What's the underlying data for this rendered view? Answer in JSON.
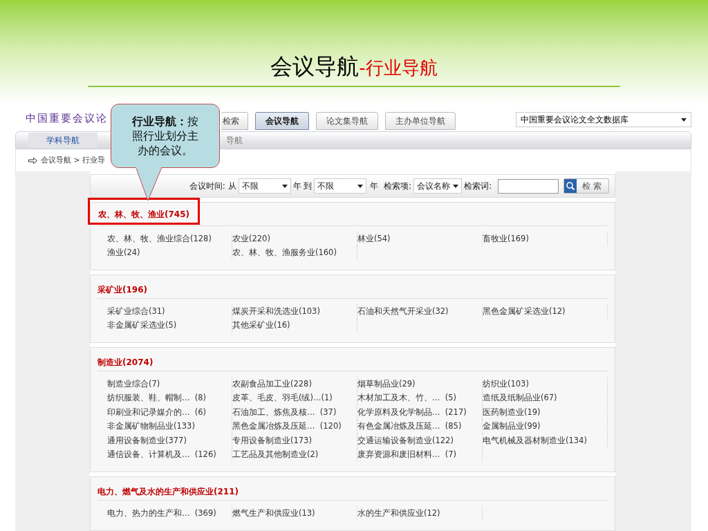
{
  "slide_title": {
    "main": "会议导航",
    "sub": "-行业导航"
  },
  "header": {
    "logo": "中国重要会议论",
    "tabs": [
      {
        "label": "检索",
        "selected": false
      },
      {
        "label": "会议导航",
        "selected": true
      },
      {
        "label": "论文集导航",
        "selected": false
      },
      {
        "label": "主办单位导航",
        "selected": false
      }
    ],
    "database_select": "中国重要会议论文全文数据库"
  },
  "subtabs": [
    "学科导航",
    "导航"
  ],
  "breadcrumb": "会议导航 > 行业导",
  "callout": "**行业导航：**按照行业划分主办的会议。",
  "search": {
    "time_label": "会议时间: 从",
    "from": "不限",
    "to_label": "年 到",
    "to": "不限",
    "field_label": "年  检索项:",
    "field": "会议名称",
    "keyword_label": "检索词:",
    "button": "检 索"
  },
  "sections": [
    {
      "title": "农、林、牧、渔业(745)",
      "highlighted": true,
      "items": [
        "农、林、牧、渔业综合(128)",
        "农业(220)",
        "林业(54)",
        "畜牧业(169)",
        "渔业(24)",
        "农、林、牧、渔服务业(160)"
      ]
    },
    {
      "title": "采矿业(196)",
      "highlighted": false,
      "items": [
        "采矿业综合(31)",
        "煤炭开采和洗选业(103)",
        "石油和天然气开采业(32)",
        "黑色金属矿采选业(12)",
        "非金属矿采选业(5)",
        "其他采矿业(16)"
      ]
    },
    {
      "title": "制造业(2074)",
      "highlighted": false,
      "items": [
        "制造业综合(7)",
        "农副食品加工业(228)",
        "烟草制品业(29)",
        "纺织业(103)",
        "纺织服装、鞋、帽制…  (8)",
        "皮革、毛皮、羽毛(绒)…(1)",
        "木材加工及木、竹、…  (5)",
        "造纸及纸制品业(67)",
        "印刷业和记录媒介的…  (6)",
        "石油加工、炼焦及核…  (37)",
        "化学原料及化学制品…  (217)",
        "医药制造业(19)",
        "非金属矿物制品业(133)",
        "黑色金属冶炼及压延…  (120)",
        "有色金属冶炼及压延…  (85)",
        "金属制品业(99)",
        "通用设备制造业(377)",
        "专用设备制造业(173)",
        "交通运输设备制造业(122)",
        "电气机械及器材制造业(134)",
        "通信设备、计算机及…  (126)",
        "工艺品及其他制造业(2)",
        "废弃资源和废旧材料…  (7)"
      ]
    },
    {
      "title": "电力、燃气及水的生产和供应业(211)",
      "highlighted": false,
      "items": [
        "电力、热力的生产和…  (369)",
        "燃气生产和供应业(13)",
        "水的生产和供应业(12)"
      ]
    }
  ]
}
